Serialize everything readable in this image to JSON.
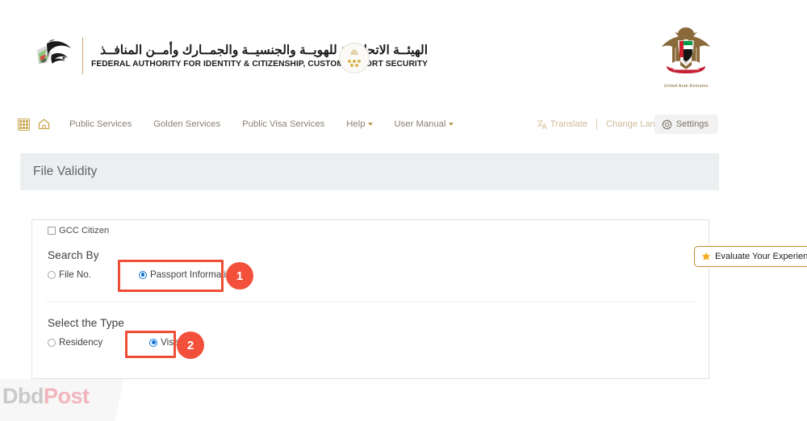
{
  "header": {
    "logo": {
      "arabic_title": "الهيئــة الاتحاديــة للهويــة والجنسيــة والجمــارك وأمــن المنافــذ",
      "english_title": "FEDERAL AUTHORITY FOR IDENTITY & CITIZENSHIP, CUSTOMS & PORT SECURITY",
      "falcon_icon": "falcon-logo-icon",
      "seal_icon": "government-seal-icon"
    },
    "emblem": {
      "caption": "United Arab Emirates",
      "icon": "uae-coat-of-arms-icon"
    }
  },
  "nav": {
    "grid_icon": "apps-grid-icon",
    "home_icon": "home-icon",
    "links": [
      {
        "label": "Public Services",
        "has_caret": false
      },
      {
        "label": "Golden Services",
        "has_caret": false
      },
      {
        "label": "Public Visa Services",
        "has_caret": false
      },
      {
        "label": "Help",
        "has_caret": true
      },
      {
        "label": "User Manual",
        "has_caret": true
      }
    ],
    "translate": {
      "label": "Translate",
      "icon": "translate-icon"
    },
    "change_language": {
      "label": "Change Language"
    },
    "search": {
      "icon": "search-icon"
    },
    "settings": {
      "label": "Settings",
      "icon": "gear-icon"
    }
  },
  "page": {
    "title": "File Validity"
  },
  "form": {
    "gcc_checkbox": {
      "label": "GCC Citizen",
      "checked": false
    },
    "search_by": {
      "section_label": "Search By",
      "options": [
        {
          "label": "File No.",
          "selected": false
        },
        {
          "label": "Passport Information",
          "selected": true
        }
      ]
    },
    "select_type": {
      "section_label": "Select the Type",
      "options": [
        {
          "label": "Residency",
          "selected": false
        },
        {
          "label": "Visa",
          "selected": true
        }
      ]
    }
  },
  "annotations": {
    "highlight_color": "#ef4e36",
    "badge_color": "#f3503c",
    "steps": [
      {
        "number": "1",
        "target": "Passport Information"
      },
      {
        "number": "2",
        "target": "Visa"
      }
    ]
  },
  "evaluate_tab": {
    "label": "Evaluate Your Experience",
    "icon": "star-icon",
    "border_color": "#b8902f"
  },
  "watermark": {
    "part_one": "Dbd",
    "part_two": "Post"
  }
}
